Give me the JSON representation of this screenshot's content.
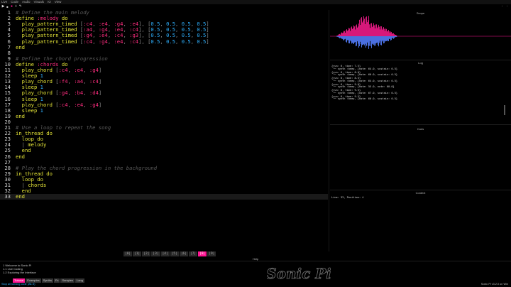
{
  "menu": [
    "Live",
    "Code",
    "Audio",
    "Visuals",
    "IO",
    "View"
  ],
  "toolbar": {
    "run_icon": "play-icon",
    "stop_icon": "stop-icon",
    "record_icon": "record-icon",
    "save_icon": "save-icon",
    "load_icon": "load-icon"
  },
  "editor": {
    "current_line": 33,
    "lines": [
      {
        "n": "1",
        "tokens": [
          [
            "c",
            "# Define the main melody"
          ]
        ]
      },
      {
        "n": "2",
        "tokens": [
          [
            "k",
            "define "
          ],
          [
            "s",
            ":melody"
          ],
          [
            "k",
            " do"
          ]
        ]
      },
      {
        "n": "3",
        "tokens": [
          [
            "k",
            "  play_pattern_timed "
          ],
          [
            "p",
            "["
          ],
          [
            "s",
            ":c4"
          ],
          [
            "p",
            ", "
          ],
          [
            "s",
            ":e4"
          ],
          [
            "p",
            ", "
          ],
          [
            "s",
            ":g4"
          ],
          [
            "p",
            ", "
          ],
          [
            "s",
            ":e4"
          ],
          [
            "p",
            "], ["
          ],
          [
            "n",
            "0.5"
          ],
          [
            "p",
            ", "
          ],
          [
            "n",
            "0.5"
          ],
          [
            "p",
            ", "
          ],
          [
            "n",
            "0.5"
          ],
          [
            "p",
            ", "
          ],
          [
            "n",
            "0.5"
          ],
          [
            "p",
            "]"
          ]
        ]
      },
      {
        "n": "4",
        "tokens": [
          [
            "k",
            "  play_pattern_timed "
          ],
          [
            "p",
            "["
          ],
          [
            "s",
            ":a4"
          ],
          [
            "p",
            ", "
          ],
          [
            "s",
            ":g4"
          ],
          [
            "p",
            ", "
          ],
          [
            "s",
            ":e4"
          ],
          [
            "p",
            ", "
          ],
          [
            "s",
            ":c4"
          ],
          [
            "p",
            "], ["
          ],
          [
            "n",
            "0.5"
          ],
          [
            "p",
            ", "
          ],
          [
            "n",
            "0.5"
          ],
          [
            "p",
            ", "
          ],
          [
            "n",
            "0.5"
          ],
          [
            "p",
            ", "
          ],
          [
            "n",
            "0.5"
          ],
          [
            "p",
            "]"
          ]
        ]
      },
      {
        "n": "5",
        "tokens": [
          [
            "k",
            "  play_pattern_timed "
          ],
          [
            "p",
            "["
          ],
          [
            "s",
            ":g4"
          ],
          [
            "p",
            ", "
          ],
          [
            "s",
            ":e4"
          ],
          [
            "p",
            ", "
          ],
          [
            "s",
            ":c4"
          ],
          [
            "p",
            ", "
          ],
          [
            "s",
            ":g3"
          ],
          [
            "p",
            "], ["
          ],
          [
            "n",
            "0.5"
          ],
          [
            "p",
            ", "
          ],
          [
            "n",
            "0.5"
          ],
          [
            "p",
            ", "
          ],
          [
            "n",
            "0.5"
          ],
          [
            "p",
            ", "
          ],
          [
            "n",
            "0.5"
          ],
          [
            "p",
            "]"
          ]
        ]
      },
      {
        "n": "6",
        "tokens": [
          [
            "k",
            "  play_pattern_timed "
          ],
          [
            "p",
            "["
          ],
          [
            "s",
            ":c4"
          ],
          [
            "p",
            ", "
          ],
          [
            "s",
            ":g4"
          ],
          [
            "p",
            ", "
          ],
          [
            "s",
            ":e4"
          ],
          [
            "p",
            ", "
          ],
          [
            "s",
            ":c4"
          ],
          [
            "p",
            "], ["
          ],
          [
            "n",
            "0.5"
          ],
          [
            "p",
            ", "
          ],
          [
            "n",
            "0.5"
          ],
          [
            "p",
            ", "
          ],
          [
            "n",
            "0.5"
          ],
          [
            "p",
            ", "
          ],
          [
            "n",
            "0.5"
          ],
          [
            "p",
            "]"
          ]
        ]
      },
      {
        "n": "7",
        "tokens": [
          [
            "k",
            "end"
          ]
        ]
      },
      {
        "n": "8",
        "tokens": []
      },
      {
        "n": "9",
        "tokens": [
          [
            "c",
            "# Define the chord progression"
          ]
        ]
      },
      {
        "n": "10",
        "tokens": [
          [
            "k",
            "define "
          ],
          [
            "s",
            ":chords"
          ],
          [
            "k",
            " do"
          ]
        ]
      },
      {
        "n": "11",
        "tokens": [
          [
            "k",
            "  play_chord "
          ],
          [
            "p",
            "["
          ],
          [
            "s",
            ":c4"
          ],
          [
            "p",
            ", "
          ],
          [
            "s",
            ":e4"
          ],
          [
            "p",
            ", "
          ],
          [
            "s",
            ":g4"
          ],
          [
            "p",
            "]"
          ]
        ]
      },
      {
        "n": "12",
        "tokens": [
          [
            "k",
            "  sleep "
          ],
          [
            "n",
            "1"
          ]
        ]
      },
      {
        "n": "13",
        "tokens": [
          [
            "k",
            "  play_chord "
          ],
          [
            "p",
            "["
          ],
          [
            "s",
            ":f4"
          ],
          [
            "p",
            ", "
          ],
          [
            "s",
            ":a4"
          ],
          [
            "p",
            ", "
          ],
          [
            "s",
            ":c4"
          ],
          [
            "p",
            "]"
          ]
        ]
      },
      {
        "n": "14",
        "tokens": [
          [
            "k",
            "  sleep "
          ],
          [
            "n",
            "1"
          ]
        ]
      },
      {
        "n": "15",
        "tokens": [
          [
            "k",
            "  play_chord "
          ],
          [
            "p",
            "["
          ],
          [
            "s",
            ":g4"
          ],
          [
            "p",
            ", "
          ],
          [
            "s",
            ":b4"
          ],
          [
            "p",
            ", "
          ],
          [
            "s",
            ":d4"
          ],
          [
            "p",
            "]"
          ]
        ]
      },
      {
        "n": "16",
        "tokens": [
          [
            "k",
            "  sleep "
          ],
          [
            "n",
            "1"
          ]
        ]
      },
      {
        "n": "17",
        "tokens": [
          [
            "k",
            "  play_chord "
          ],
          [
            "p",
            "["
          ],
          [
            "s",
            ":c4"
          ],
          [
            "p",
            ", "
          ],
          [
            "s",
            ":e4"
          ],
          [
            "p",
            ", "
          ],
          [
            "s",
            ":g4"
          ],
          [
            "p",
            "]"
          ]
        ]
      },
      {
        "n": "18",
        "tokens": [
          [
            "k",
            "  sleep "
          ],
          [
            "n",
            "1"
          ]
        ]
      },
      {
        "n": "19",
        "tokens": [
          [
            "k",
            "end"
          ]
        ]
      },
      {
        "n": "20",
        "tokens": []
      },
      {
        "n": "21",
        "tokens": [
          [
            "c",
            "# Use a loop to repeat the song"
          ]
        ]
      },
      {
        "n": "22",
        "tokens": [
          [
            "k",
            "in_thread do"
          ]
        ]
      },
      {
        "n": "23",
        "tokens": [
          [
            "k",
            "  loop do"
          ]
        ]
      },
      {
        "n": "24",
        "tokens": [
          [
            "p",
            "  | "
          ],
          [
            "k",
            "melody"
          ]
        ]
      },
      {
        "n": "25",
        "tokens": [
          [
            "k",
            "  end"
          ]
        ]
      },
      {
        "n": "26",
        "tokens": [
          [
            "k",
            "end"
          ]
        ]
      },
      {
        "n": "27",
        "tokens": []
      },
      {
        "n": "28",
        "tokens": [
          [
            "c",
            "# Play the chord progression in the background"
          ]
        ]
      },
      {
        "n": "29",
        "tokens": [
          [
            "k",
            "in_thread do"
          ]
        ]
      },
      {
        "n": "30",
        "tokens": [
          [
            "k",
            "  loop do"
          ]
        ]
      },
      {
        "n": "31",
        "tokens": [
          [
            "p",
            "  | "
          ],
          [
            "k",
            "chords"
          ]
        ]
      },
      {
        "n": "32",
        "tokens": [
          [
            "k",
            "  end"
          ]
        ]
      },
      {
        "n": "33",
        "tokens": [
          [
            "k",
            "end"
          ]
        ]
      }
    ]
  },
  "scope": {
    "title": "Scope"
  },
  "log": {
    "title": "Log",
    "entries": [
      "{run: 6, time: 7.5}",
      " └─ synth :beep, {note: 64.0, sustain: 0.5}",
      "{run: 6, time: 8.0}",
      " └─ synth :beep, {note: 60.0, sustain: 0.5}",
      "{run: 6, time: 8.5}",
      " └─ synth :beep, {note: 64.0, sustain: 0.5}",
      "{run: 6, time: 9.0}",
      " └─ synth :beep, {note: 55.0, note: 60.0}",
      "{run: 6, time: 9.5}",
      " └─ synth :beep, {note: 67.0, sustain: 0.5}",
      "{run: 6, time: 9.5}",
      " └─ synth :beep, {note: 60.0, sustain: 0.5}"
    ]
  },
  "cues": {
    "title": "Cues"
  },
  "context": {
    "title": "Context",
    "text": "Line: 33,  Position: 4"
  },
  "buffers": [
    "0",
    "1",
    "2",
    "3",
    "4",
    "5",
    "6",
    "7",
    "8",
    "9"
  ],
  "active_buffer": "8",
  "help": {
    "title": "Help",
    "toc": [
      "1 Welcome to Sonic Pi",
      "1.1 Live Coding",
      "1.2 Exploring the Interface"
    ],
    "tabs": [
      "Tutorial",
      "Examples",
      "Synths",
      "Fx",
      "Samples",
      "Lang"
    ],
    "active_tab": "Tutorial",
    "logo_text": "Sonic Pi"
  },
  "status": {
    "left": "Stop all running code (Alt-S)",
    "right": "Sonic Pi v3.2.0 on Win"
  },
  "colors": {
    "accent": "#ff1493",
    "keyword": "#e4e437",
    "symbol": "#ff2d7f",
    "number": "#2fb1ff",
    "comment": "#5a5a5a"
  }
}
